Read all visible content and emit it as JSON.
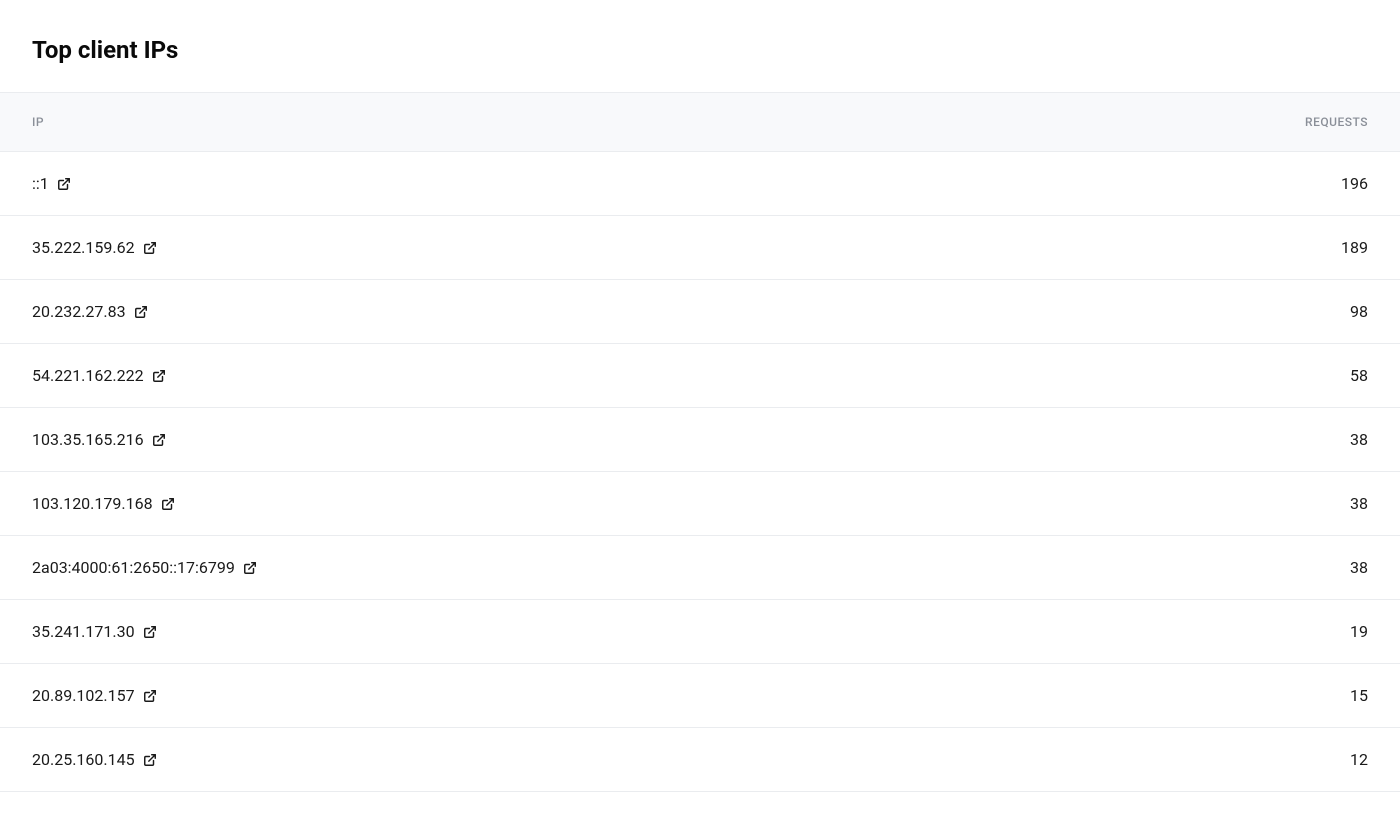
{
  "title": "Top client IPs",
  "columns": {
    "ip": "IP",
    "requests": "REQUESTS"
  },
  "rows": [
    {
      "ip": "::1",
      "requests": "196"
    },
    {
      "ip": "35.222.159.62",
      "requests": "189"
    },
    {
      "ip": "20.232.27.83",
      "requests": "98"
    },
    {
      "ip": "54.221.162.222",
      "requests": "58"
    },
    {
      "ip": "103.35.165.216",
      "requests": "38"
    },
    {
      "ip": "103.120.179.168",
      "requests": "38"
    },
    {
      "ip": "2a03:4000:61:2650::17:6799",
      "requests": "38"
    },
    {
      "ip": "35.241.171.30",
      "requests": "19"
    },
    {
      "ip": "20.89.102.157",
      "requests": "15"
    },
    {
      "ip": "20.25.160.145",
      "requests": "12"
    }
  ]
}
